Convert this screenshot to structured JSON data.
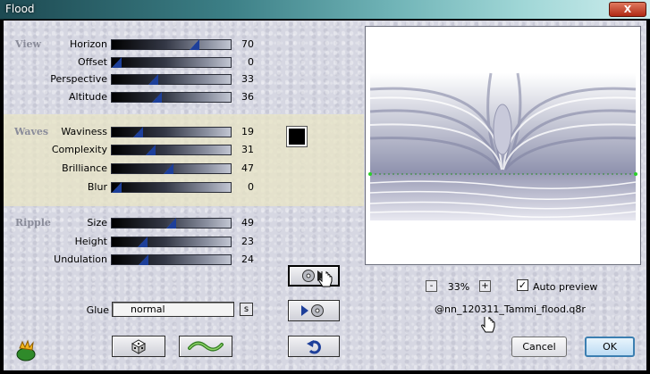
{
  "window": {
    "title": "Flood",
    "close_label": "X"
  },
  "sections": {
    "view": "View",
    "waves": "Waves",
    "ripple": "Ripple"
  },
  "sliders": {
    "horizon": {
      "label": "Horizon",
      "value": "70",
      "fraction": 0.7
    },
    "offset": {
      "label": "Offset",
      "value": "0",
      "fraction": 0.0
    },
    "perspective": {
      "label": "Perspective",
      "value": "33",
      "fraction": 0.33
    },
    "altitude": {
      "label": "Altitude",
      "value": "36",
      "fraction": 0.36
    },
    "waviness": {
      "label": "Waviness",
      "value": "19",
      "fraction": 0.19
    },
    "complexity": {
      "label": "Complexity",
      "value": "31",
      "fraction": 0.31
    },
    "brilliance": {
      "label": "Brilliance",
      "value": "47",
      "fraction": 0.47
    },
    "blur": {
      "label": "Blur",
      "value": "0",
      "fraction": 0.0
    },
    "size": {
      "label": "Size",
      "value": "49",
      "fraction": 0.49
    },
    "height": {
      "label": "Height",
      "value": "23",
      "fraction": 0.23
    },
    "undulation": {
      "label": "Undulation",
      "value": "24",
      "fraction": 0.24
    }
  },
  "wave_color": "#000000",
  "glue": {
    "label": "Glue",
    "value": "normal",
    "s_label": "s"
  },
  "zoom": {
    "minus": "-",
    "value": "33%",
    "plus": "+"
  },
  "auto_preview": {
    "label": "Auto preview",
    "checked": true,
    "mark": "✓"
  },
  "preset_name": "@nn_120311_Tammi_flood.q8r",
  "buttons": {
    "cancel": "Cancel",
    "ok": "OK"
  },
  "icons": {
    "app": "filter-plugin-icon",
    "random": "dice-icon",
    "wave": "wave-icon",
    "reset": "undo-icon",
    "save_preset": "save-preset-icon",
    "load_preset": "load-preset-icon"
  }
}
